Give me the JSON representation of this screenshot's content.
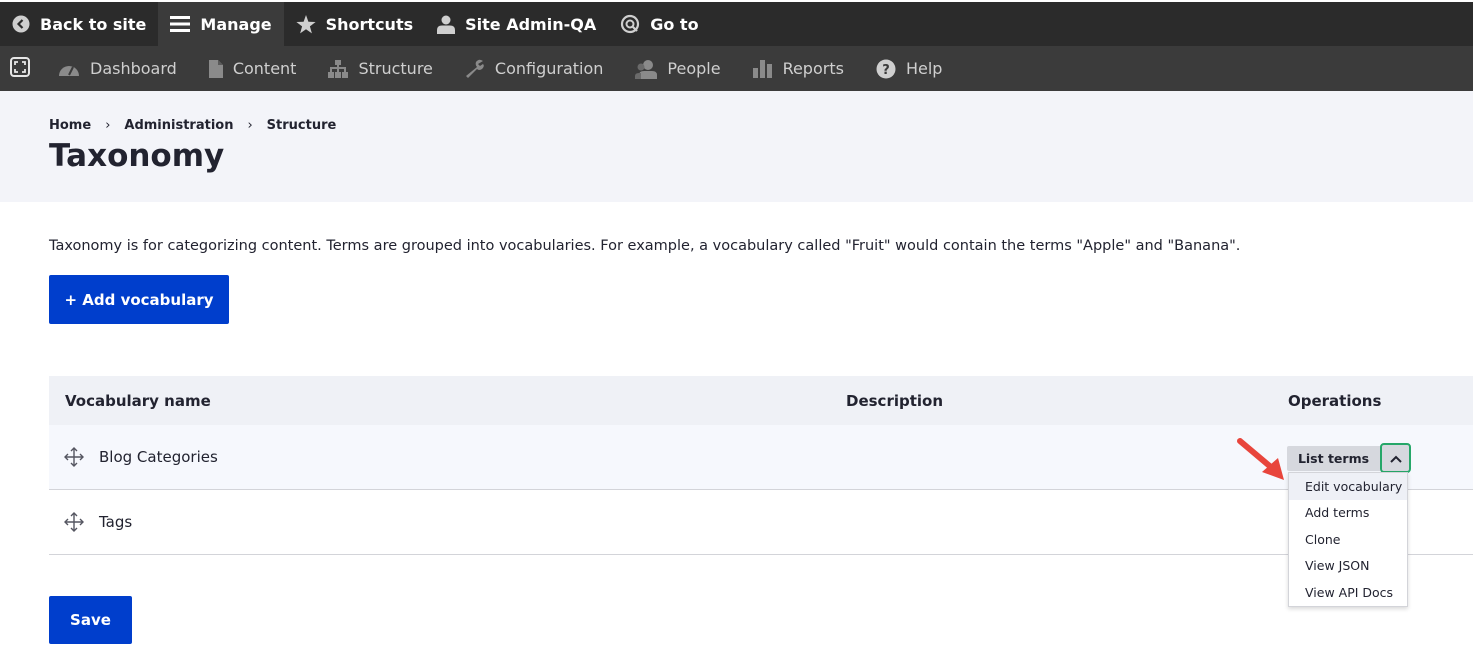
{
  "toolbar": {
    "back": "Back to site",
    "manage": "Manage",
    "shortcuts": "Shortcuts",
    "user": "Site Admin-QA",
    "goto": "Go to"
  },
  "tray": {
    "items": [
      "Dashboard",
      "Content",
      "Structure",
      "Configuration",
      "People",
      "Reports",
      "Help"
    ]
  },
  "breadcrumb": [
    "Home",
    "Administration",
    "Structure"
  ],
  "breadcrumb_sep": "›",
  "page_title": "Taxonomy",
  "intro": "Taxonomy is for categorizing content. Terms are grouped into vocabularies. For example, a vocabulary called \"Fruit\" would contain the terms \"Apple\" and \"Banana\".",
  "add_button": "+ Add vocabulary",
  "table": {
    "headers": {
      "name": "Vocabulary name",
      "description": "Description",
      "operations": "Operations"
    },
    "rows": [
      {
        "name": "Blog Categories",
        "description": ""
      },
      {
        "name": "Tags",
        "description": ""
      }
    ]
  },
  "dropbutton": {
    "main": "List terms",
    "menu": [
      "Edit vocabulary",
      "Add terms",
      "Clone",
      "View JSON",
      "View API Docs"
    ]
  },
  "save_button": "Save",
  "colors": {
    "toolbar": "#2b2b2b",
    "tray": "#3b3b3b",
    "primary": "#003ecc",
    "highlight": "#26a769",
    "arrow": "#e8453c"
  }
}
